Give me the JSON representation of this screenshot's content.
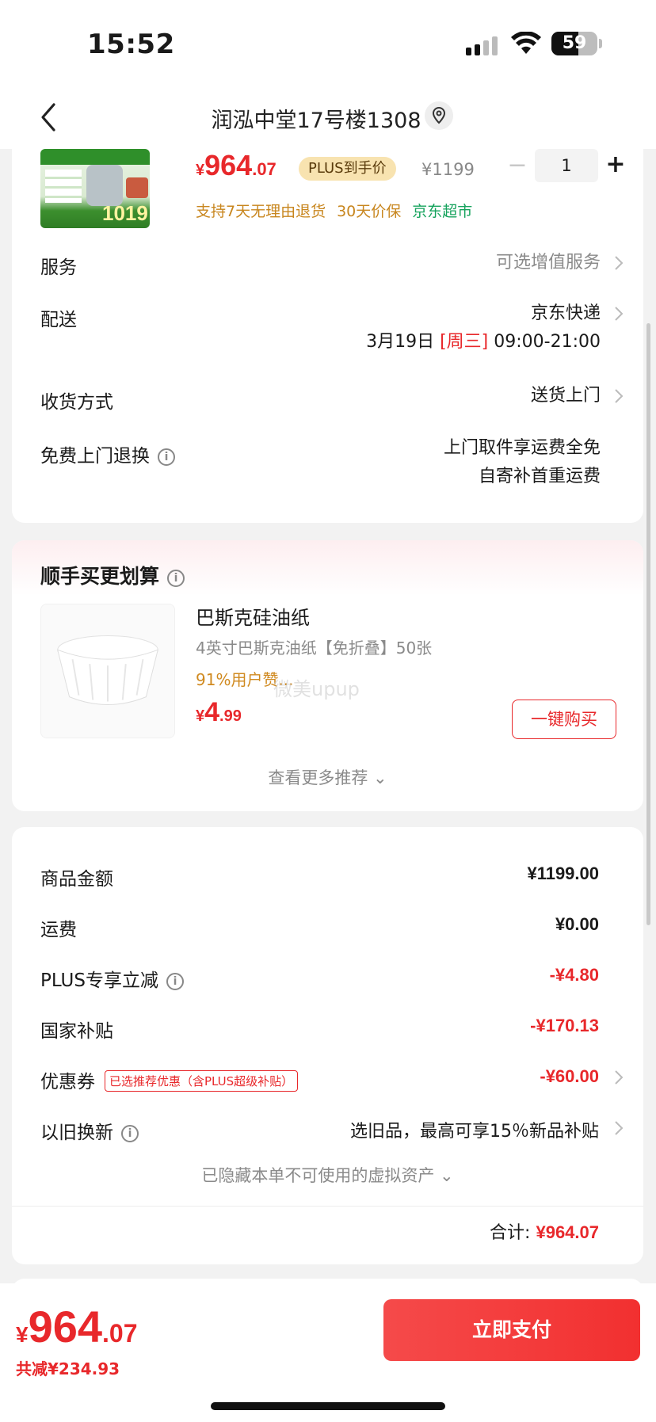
{
  "status_bar": {
    "time": "15:52",
    "battery": "59"
  },
  "nav": {
    "title": "润泓中堂17号楼1308"
  },
  "product": {
    "thumb_text": "1019",
    "price_yen": "¥",
    "price_int": "964",
    "price_dec": ".07",
    "plus_badge": "PLUS到手价",
    "orig_price": "¥1199",
    "qty_minus": "−",
    "quantity": "1",
    "qty_plus": "+",
    "tags": [
      "支持7天无理由退货",
      "30天价保",
      "京东超市"
    ]
  },
  "rows": {
    "service_label": "服务",
    "service_value": "可选增值服务",
    "delivery_label": "配送",
    "delivery_carrier": "京东快递",
    "delivery_date": "3月19日",
    "delivery_weekday": "[周三]",
    "delivery_time": "09:00-21:00",
    "receive_label": "收货方式",
    "receive_value": "送货上门",
    "return_label": "免费上门退换",
    "return_value_1": "上门取件享运费全免",
    "return_value_2": "自寄补首重运费"
  },
  "recommend": {
    "title": "顺手买更划算",
    "name": "巴斯克硅油纸",
    "desc": "4英寸巴斯克油纸【免折叠】50张",
    "rate": "91%用户赞...",
    "watermark": "微美upup",
    "price_yen": "¥",
    "price_int": "4",
    "price_dec": ".99",
    "buy_label": "一键购买",
    "more_label": "查看更多推荐 ⌄"
  },
  "amounts": {
    "goods_label": "商品金额",
    "goods_value": "¥1199.00",
    "shipping_label": "运费",
    "shipping_value": "¥0.00",
    "plus_label": "PLUS专享立减",
    "plus_value": "-¥4.80",
    "subsidy_label": "国家补贴",
    "subsidy_value": "-¥170.13",
    "coupon_label": "优惠券",
    "coupon_tag": "已选推荐优惠（含PLUS超级补贴）",
    "coupon_value": "-¥60.00",
    "tradein_label": "以旧换新",
    "tradein_value": "选旧品，最高可享15％新品补贴",
    "hidden_assets": "已隐藏本单不可使用的虚拟资产 ⌄",
    "total_label": "合计:",
    "total_value": "¥964.07"
  },
  "bottom": {
    "price_yen": "¥",
    "price_int": "964",
    "price_dec": ".07",
    "saving": "共减¥234.93",
    "pay_label": "立即支付"
  },
  "colors": {
    "accent_red": "#e8282b",
    "green": "#16a35d",
    "orange": "#c8861e"
  },
  "icons": [
    "back-icon",
    "location-icon",
    "info-icon",
    "chevron-right-icon",
    "chevron-down-icon",
    "signal-icon",
    "wifi-icon",
    "battery-icon"
  ]
}
